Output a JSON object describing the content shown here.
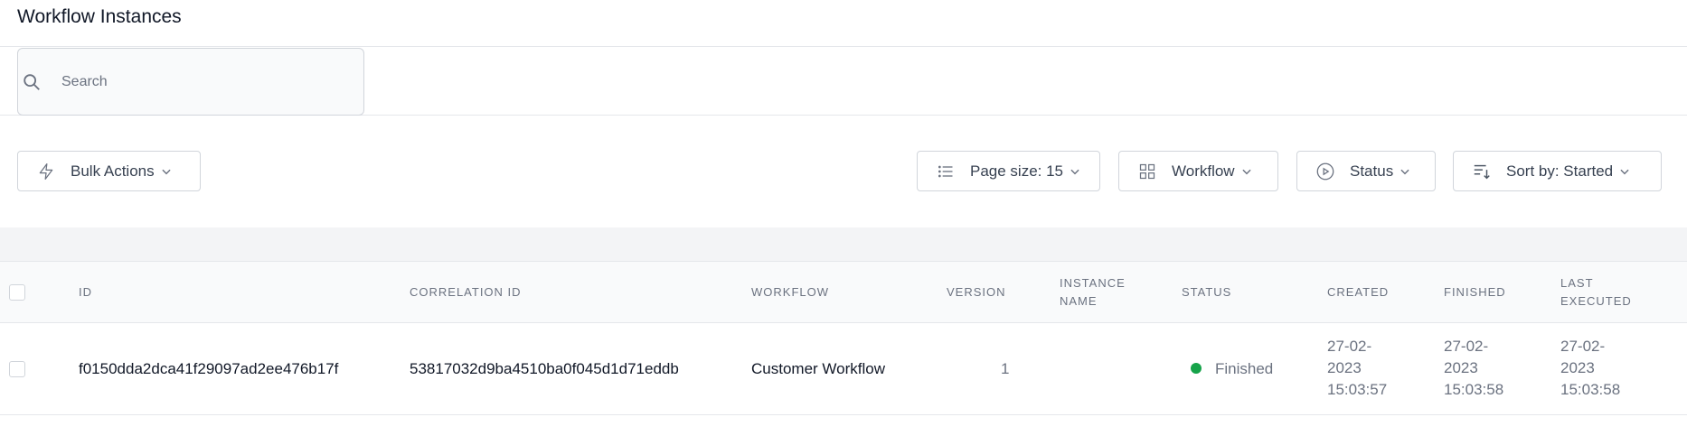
{
  "page": {
    "title": "Workflow Instances"
  },
  "search": {
    "placeholder": "Search",
    "value": ""
  },
  "toolbar": {
    "bulk_actions": "Bulk Actions",
    "page_size": "Page size: 15",
    "workflow": "Workflow",
    "status": "Status",
    "sort_by": "Sort by: Started"
  },
  "table": {
    "headers": {
      "id": "ID",
      "correlation_id": "CORRELATION ID",
      "workflow": "WORKFLOW",
      "version": "VERSION",
      "instance_name_1": "INSTANCE",
      "instance_name_2": "NAME",
      "status": "STATUS",
      "created": "CREATED",
      "finished": "FINISHED",
      "last_executed_1": "LAST",
      "last_executed_2": "EXECUTED"
    },
    "rows": [
      {
        "id": "f0150dda2dca41f29097ad2ee476b17f",
        "correlation_id": "53817032d9ba4510ba0f045d1d71eddb",
        "workflow": "Customer Workflow",
        "version": "1",
        "instance_name": "",
        "status": "Finished",
        "status_color": "#16a34a",
        "created_date": "27-02-",
        "created_year": "2023",
        "created_time": "15:03:57",
        "finished_date": "27-02-",
        "finished_year": "2023",
        "finished_time": "15:03:58",
        "last_executed_date": "27-02-",
        "last_executed_year": "2023",
        "last_executed_time": "15:03:58"
      }
    ]
  },
  "icons": {
    "search": "search-icon",
    "bulk": "lightning-icon",
    "page_size": "list-icon",
    "workflow": "grid-icon",
    "status": "play-circle-icon",
    "sort": "sort-icon",
    "chevron": "chevron-down-icon"
  }
}
